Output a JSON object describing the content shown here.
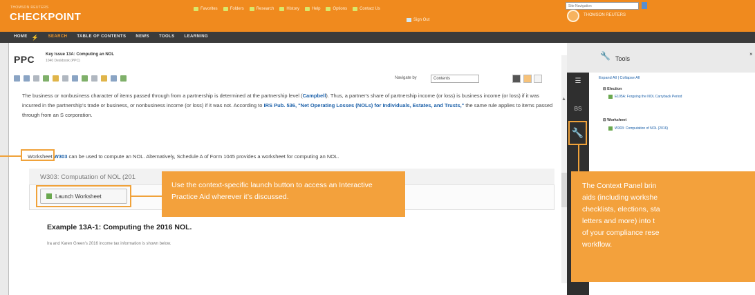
{
  "app": {
    "brand_small": "THOMSON REUTERS",
    "brand": "CHECKPOINT",
    "top_links": [
      "Favorites",
      "Folders",
      "Research",
      "History",
      "Help",
      "Options",
      "Contact Us"
    ],
    "sign_out": "Sign Out",
    "corp_name": "THOMSON REUTERS"
  },
  "nav": {
    "items": [
      "HOME",
      "SEARCH",
      "TABLE OF CONTENTS",
      "NEWS",
      "TOOLS",
      "LEARNING"
    ],
    "active": "SEARCH",
    "search_placeholder": "Site Navigation"
  },
  "doc": {
    "abbr": "PPC",
    "title": "Key Issue 13A: Computing an NOL",
    "subtitle": "1040 Deskbook (PPC)",
    "navigate_label": "Navigate by",
    "navigate_value": "Contents",
    "paragraph_part1": "The business or nonbusiness character of items passed through from a partnership is determined at the partnership level (",
    "paragraph_link1": "Campbell",
    "paragraph_part2": "). Thus, a partner's share of partnership income (or loss) is business income (or loss) if it was incurred in the partnership's trade or business, or nonbusiness income (or loss) if it was not. According to ",
    "paragraph_link2": "IRS Pub. 536, \"Net Operating Losses (NOLs) for Individuals, Estates, and Trusts,\"",
    "paragraph_part3": " the same rule applies to items passed through from an S corporation.",
    "ws_prefix": "Worksheet ",
    "ws_link": "W303",
    "ws_suffix": " can be used to compute an NOL. Alternatively, Schedule A of Form 1045 provides a worksheet for computing an NOL.",
    "panel_heading": "W303: Computation of NOL (201",
    "launch_button": "Launch Worksheet",
    "example_title": "Example 13A-1: Computing the 2016 NOL.",
    "example_text": "Ira and Karen Green's 2016 income tax information is shown below."
  },
  "callouts": {
    "launch": "Use the context-specific launch button to access an Interactive Practice Aid wherever it’s discussed.",
    "context_lines": [
      "The Context Panel brin",
      "aids (including workshe",
      "checklists, elections, sta",
      "letters and more) into t",
      "of your compliance rese",
      "workflow."
    ]
  },
  "tools": {
    "title": "Tools",
    "expand": "Expand All",
    "collapse": "Collapse All",
    "groups": [
      {
        "label": "Election",
        "item": "E105A: Forgoing the NOL Carryback Period"
      },
      {
        "label": "Worksheet",
        "item": "W303: Computation of NOL (2016)"
      }
    ]
  },
  "colors": {
    "brand_orange": "#f08a1e",
    "callout_orange": "#f3a13c",
    "nav_dark": "#3b3b3b",
    "link_blue": "#1a5fa8"
  }
}
